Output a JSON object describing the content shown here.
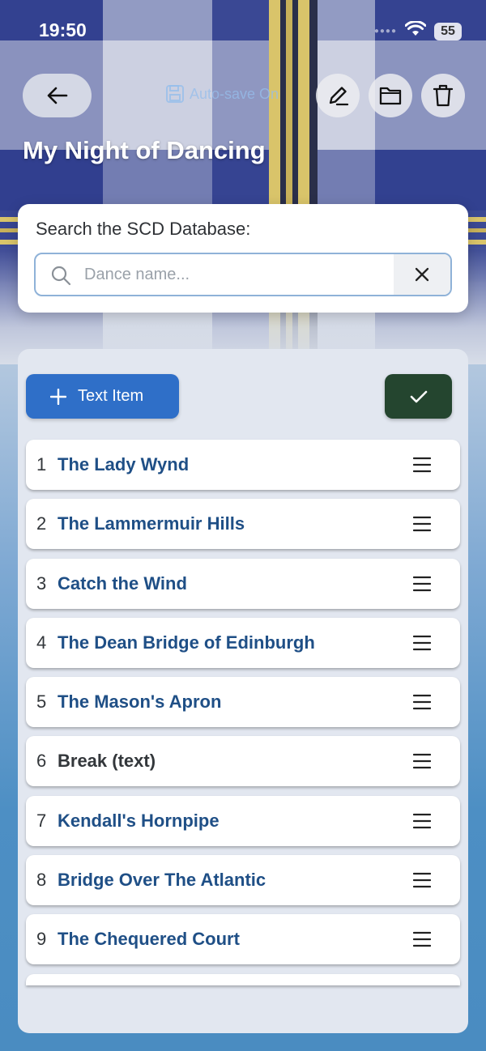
{
  "status_bar": {
    "time": "19:50",
    "battery": "55"
  },
  "toolbar": {
    "autosave_label": "Auto-save On"
  },
  "page": {
    "title": "My Night of Dancing"
  },
  "search": {
    "label": "Search the SCD Database:",
    "placeholder": "Dance name..."
  },
  "actions": {
    "add_text_label": "Text Item"
  },
  "dances": [
    {
      "num": "1",
      "title": "The Lady Wynd"
    },
    {
      "num": "2",
      "title": "The Lammermuir Hills"
    },
    {
      "num": "3",
      "title": "Catch the Wind"
    },
    {
      "num": "4",
      "title": "The Dean Bridge of Edinburgh"
    },
    {
      "num": "5",
      "title": "The Mason's Apron"
    },
    {
      "num": "6",
      "title": "Break (text)"
    },
    {
      "num": "7",
      "title": "Kendall's Hornpipe"
    },
    {
      "num": "8",
      "title": "Bridge Over The Atlantic"
    },
    {
      "num": "9",
      "title": "The Chequered Court"
    }
  ],
  "colors": {
    "primary_blue": "#2f6fc8",
    "confirm_green": "#24452f",
    "dance_title": "#1f4f86",
    "tartan_navy": "#2b3a8c",
    "tartan_gold": "#d9c46a"
  },
  "icons": [
    "back-arrow-icon",
    "save-icon",
    "pencil-icon",
    "folder-icon",
    "trash-icon",
    "search-icon",
    "close-icon",
    "plus-icon",
    "check-icon",
    "drag-handle-icon",
    "wifi-icon"
  ]
}
